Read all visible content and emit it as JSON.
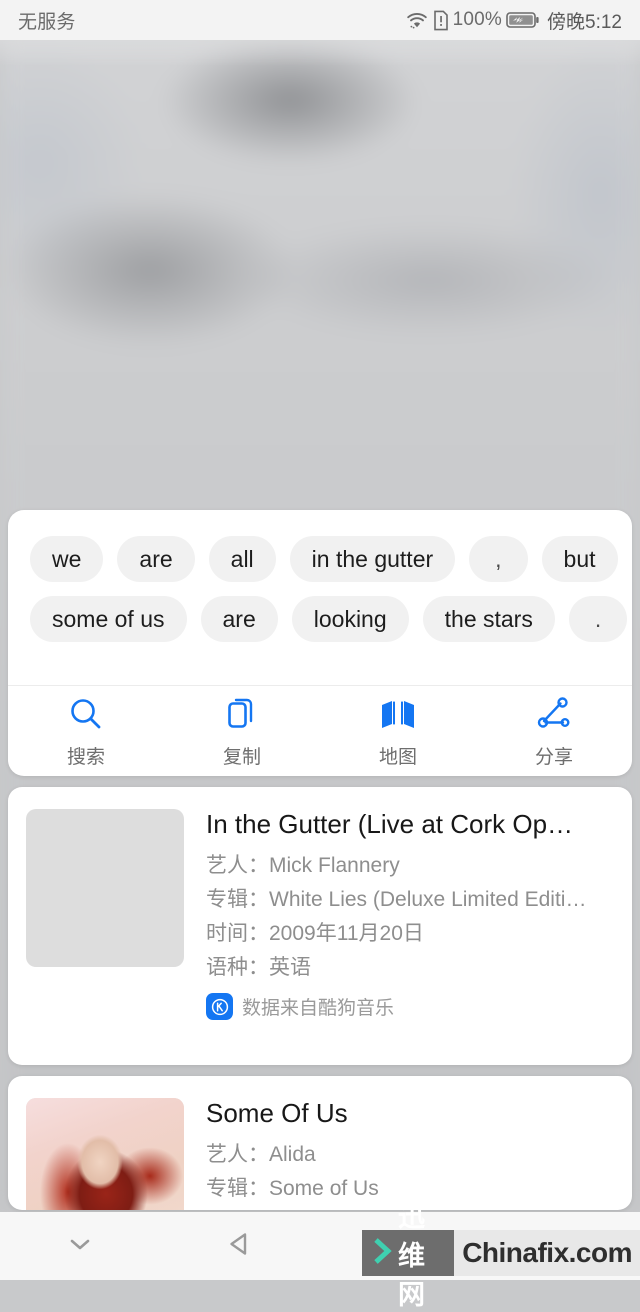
{
  "status_bar": {
    "carrier": "无服务",
    "battery_percent": "100%",
    "time": "傍晚5:12",
    "icons": [
      "wifi-icon",
      "sim-alert-icon",
      "battery-icon"
    ]
  },
  "selection_panel": {
    "chip_rows": [
      [
        {
          "text": "we",
          "type": "word"
        },
        {
          "text": "are",
          "type": "word"
        },
        {
          "text": "all",
          "type": "word"
        },
        {
          "text": "in the gutter",
          "type": "word"
        },
        {
          "text": ",",
          "type": "punct"
        },
        {
          "text": "but",
          "type": "word"
        }
      ],
      [
        {
          "text": "some of us",
          "type": "word"
        },
        {
          "text": "are",
          "type": "word"
        },
        {
          "text": "looking",
          "type": "word"
        },
        {
          "text": "the stars",
          "type": "word"
        },
        {
          "text": ".",
          "type": "punct"
        }
      ]
    ],
    "tools": [
      {
        "label": "搜索",
        "icon": "search-icon"
      },
      {
        "label": "复制",
        "icon": "copy-icon"
      },
      {
        "label": "地图",
        "icon": "map-icon"
      },
      {
        "label": "分享",
        "icon": "share-icon"
      }
    ],
    "accent_color": "#1476f2"
  },
  "results": [
    {
      "title": "In the Gutter (Live at Cork Op…",
      "artist_label": "艺人：",
      "artist": "Mick Flannery",
      "album_label": "专辑：",
      "album": "White Lies (Deluxe Limited Editi…",
      "date_label": "时间：",
      "date": "2009年11月20日",
      "language_label": "语种：",
      "language": "英语",
      "source": "数据来自酷狗音乐",
      "source_badge": "K",
      "thumbnail": "album-art-man-leather-jacket"
    },
    {
      "title": "Some Of Us",
      "artist_label": "艺人：",
      "artist": "Alida",
      "album_label": "专辑：",
      "album": "Some of Us",
      "thumbnail": "album-art-red-haired-woman"
    }
  ],
  "navigation_bar": {
    "buttons": [
      {
        "name": "hide-keyboard",
        "icon": "chevron-down-icon"
      },
      {
        "name": "back",
        "icon": "back-triangle-icon"
      },
      {
        "name": "home",
        "icon": "home-circle-icon"
      },
      {
        "name": "recents",
        "icon": "recents-square-icon"
      }
    ]
  },
  "watermark": {
    "cn_text": "迅维网",
    "en_text": "Chinafix.com",
    "chevron_color": "#3fd0b0"
  }
}
